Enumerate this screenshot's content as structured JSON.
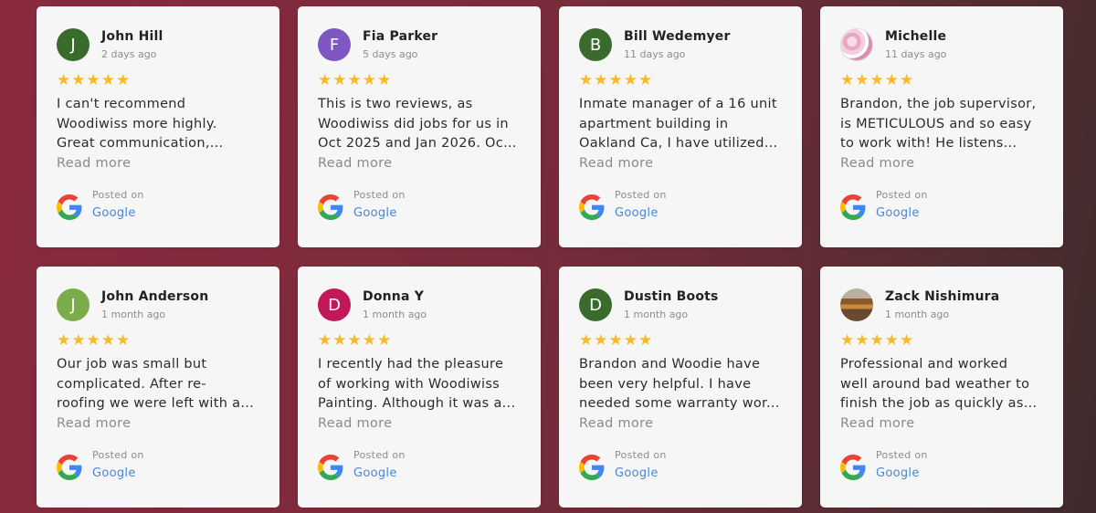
{
  "colors": {
    "star": "#f6bb26",
    "link_blue": "#4a86d8"
  },
  "reviews": [
    {
      "name": "John Hill",
      "date": "2 days ago",
      "avatar_letter": "J",
      "avatar_color": "#3b6b2c",
      "avatar_type": "letter",
      "rating": 5,
      "lines": [
        "I can't recommend",
        "Woodiwiss more highly.",
        "Great communication,..."
      ],
      "read_more": "Read more",
      "posted_on": "Posted on",
      "source": "Google",
      "icon": "google-icon"
    },
    {
      "name": "Fia Parker",
      "date": "5 days ago",
      "avatar_letter": "F",
      "avatar_color": "#7e57c2",
      "avatar_type": "letter",
      "rating": 5,
      "lines": [
        "This is two reviews, as",
        "Woodiwiss did jobs for us in",
        "Oct 2025 and Jan 2026. Oct..."
      ],
      "read_more": "Read more",
      "posted_on": "Posted on",
      "source": "Google",
      "icon": "google-icon"
    },
    {
      "name": "Bill Wedemyer",
      "date": "11 days ago",
      "avatar_letter": "B",
      "avatar_color": "#3b6b2c",
      "avatar_type": "letter",
      "rating": 5,
      "lines": [
        "Inmate manager of a 16 unit",
        "apartment building in",
        "Oakland Ca, I have utilized..."
      ],
      "read_more": "Read more",
      "posted_on": "Posted on",
      "source": "Google",
      "icon": "google-icon"
    },
    {
      "name": "Michelle",
      "date": "11 days ago",
      "avatar_letter": "",
      "avatar_color": "#e7a7c3",
      "avatar_type": "photo-flower",
      "rating": 5,
      "lines": [
        "Brandon, the job supervisor,",
        "is METICULOUS and so easy",
        "to work with! He listens..."
      ],
      "read_more": "Read more",
      "posted_on": "Posted on",
      "source": "Google",
      "icon": "google-icon"
    },
    {
      "name": "John Anderson",
      "date": "1 month ago",
      "avatar_letter": "J",
      "avatar_color": "#7cac4a",
      "avatar_type": "letter",
      "rating": 5,
      "lines": [
        "Our job was small but",
        "complicated. After re-",
        "roofing we were left with a..."
      ],
      "read_more": "Read more",
      "posted_on": "Posted on",
      "source": "Google",
      "icon": "google-icon"
    },
    {
      "name": "Donna Y",
      "date": "1 month ago",
      "avatar_letter": "D",
      "avatar_color": "#c2185b",
      "avatar_type": "letter",
      "rating": 5,
      "lines": [
        "I recently had the pleasure",
        "of working with Woodiwiss",
        "Painting. Although it was a..."
      ],
      "read_more": "Read more",
      "posted_on": "Posted on",
      "source": "Google",
      "icon": "google-icon"
    },
    {
      "name": "Dustin Boots",
      "date": "1 month ago",
      "avatar_letter": "D",
      "avatar_color": "#3b6b2c",
      "avatar_type": "letter",
      "rating": 5,
      "lines": [
        "Brandon and Woodie have",
        "been very helpful. I have",
        "needed some warranty wor..."
      ],
      "read_more": "Read more",
      "posted_on": "Posted on",
      "source": "Google",
      "icon": "google-icon"
    },
    {
      "name": "Zack Nishimura",
      "date": "1 month ago",
      "avatar_letter": "",
      "avatar_color": "#8a5a2c",
      "avatar_type": "photo-street",
      "rating": 5,
      "lines": [
        "Professional and worked",
        "well around bad weather to",
        "finish the job as quickly as..."
      ],
      "read_more": "Read more",
      "posted_on": "Posted on",
      "source": "Google",
      "icon": "google-icon"
    }
  ]
}
